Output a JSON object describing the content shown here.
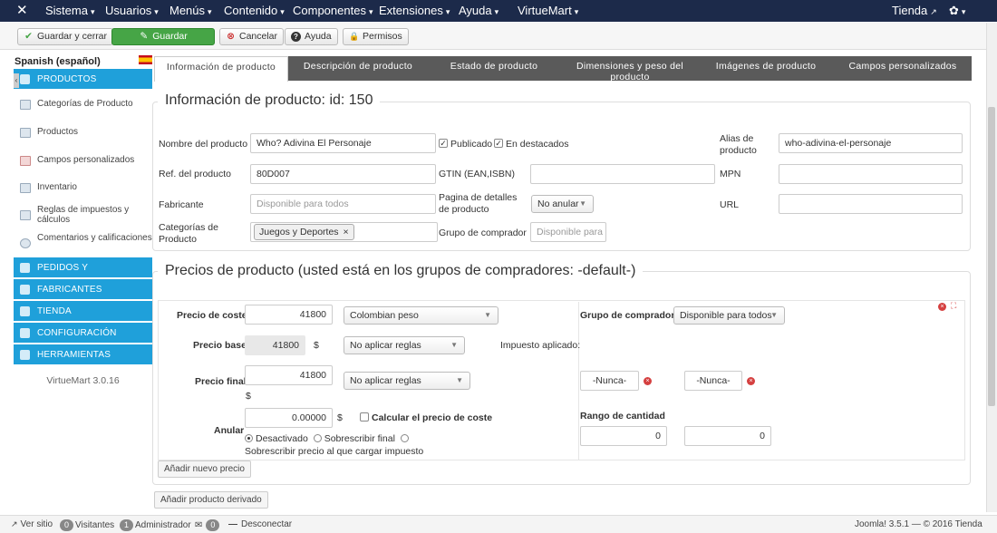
{
  "topnav": {
    "menus": [
      "Sistema",
      "Usuarios",
      "Menús",
      "Contenido",
      "Componentes",
      "Extensiones",
      "Ayuda",
      "VirtueMart"
    ],
    "site": "Tienda",
    "caret": "▾",
    "logo_glyph": "✕",
    "gear_glyph": "✿"
  },
  "toolbar": {
    "save_close": "Guardar y cerrar",
    "save": "Guardar",
    "cancel": "Cancelar",
    "help": "Ayuda",
    "permissions": "Permisos",
    "icons": {
      "save_close": "✔",
      "save": "✎",
      "cancel": "⊗",
      "help": "?",
      "permissions": "🔒"
    }
  },
  "sidebar": {
    "language": "Spanish (español)",
    "sections": [
      "PRODUCTOS",
      "PEDIDOS Y",
      "FABRICANTES",
      "TIENDA",
      "CONFIGURACIÓN",
      "HERRAMIENTAS"
    ],
    "items": [
      "Categorías de Producto",
      "Productos",
      "Campos personalizados",
      "Inventario",
      "Reglas de impuestos y cálculos",
      "Comentarios y calificaciones"
    ],
    "version": "VirtueMart 3.0.16"
  },
  "tabs": [
    "Información de producto",
    "Descripción de producto",
    "Estado de producto",
    "Dimensiones y peso del producto",
    "Imágenes de producto",
    "Campos personalizados"
  ],
  "product_info": {
    "legend": "Información de producto: id: 150",
    "name_label": "Nombre del producto",
    "name_value": "Who? Adivina El Personaje",
    "published_label": "Publicado",
    "featured_label": "En destacados",
    "alias_label": "Alias de producto",
    "alias_value": "who-adivina-el-personaje",
    "ref_label": "Ref. del producto",
    "ref_value": "80D007",
    "gtin_label": "GTIN (EAN,ISBN)",
    "gtin_value": "",
    "mpn_label": "MPN",
    "mpn_value": "",
    "manufacturer_label": "Fabricante",
    "manufacturer_placeholder": "Disponible para todos",
    "details_page_label": "Pagina de detalles de producto",
    "details_page_value": "No anular",
    "url_label": "URL",
    "url_value": "",
    "categories_label": "Categorías de Producto",
    "category_token": "Juegos y Deportes",
    "token_remove": "×",
    "shopper_group_label": "Grupo de comprador",
    "shopper_group_placeholder": "Disponible para todos"
  },
  "prices": {
    "legend": "Precios de producto (usted está en los grupos de compradores: -default-)",
    "cost_price_label": "Precio de coste",
    "cost_price_value": "41800",
    "currency": "Colombian peso",
    "shopper_group_label": "Grupo de comprador",
    "shopper_group_value": "Disponible para todos",
    "base_price_label": "Precio base",
    "base_price_value": "41800",
    "currency_symbol": "$",
    "base_rule": "No aplicar reglas",
    "tax_applied_label": "Impuesto aplicado:",
    "final_price_label": "Precio final",
    "final_price_value": "41800",
    "final_rule": "No aplicar reglas",
    "never_from": "-Nunca-",
    "never_to": "-Nunca-",
    "override_label": "Anular",
    "override_value": "0.00000",
    "calc_cost_label": "Calcular el precio de coste",
    "qty_range_label": "Rango de cantidad",
    "qty_from": "0",
    "qty_to": "0",
    "radio_disabled": "Desactivado",
    "radio_override_final": "Sobrescribir final",
    "radio_override_tax": "Sobrescribir precio al que cargar impuesto",
    "add_price_button": "Añadir nuevo precio",
    "remove_glyph": "×",
    "expand_glyph": "⛶"
  },
  "add_child_button": "Añadir producto derivado",
  "statusbar": {
    "view_site": "Ver sitio",
    "visitors_count": "0",
    "visitors_label": "Visitantes",
    "admins_count": "1",
    "admins_label": "Administrador",
    "messages_count": "0",
    "logout": "Desconectar",
    "footer": "Joomla! 3.5.1 — © 2016 Tienda"
  }
}
